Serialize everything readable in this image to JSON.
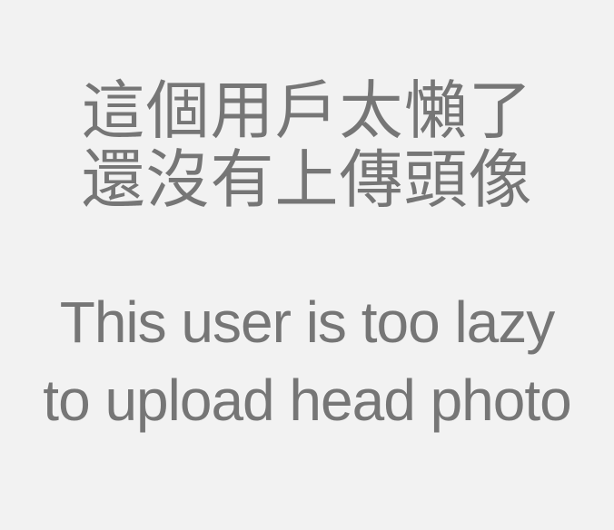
{
  "placeholder": {
    "chinese_lines": [
      "這個用戶太懶了",
      "還沒有上傳頭像"
    ],
    "english_lines": [
      "This user is too lazy",
      "to upload head photo"
    ]
  },
  "colors": {
    "background": "#f2f2f2",
    "text": "#767676"
  }
}
